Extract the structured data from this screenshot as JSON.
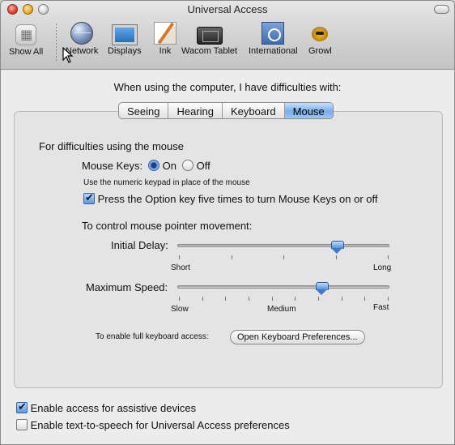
{
  "window": {
    "title": "Universal Access"
  },
  "toolbar": {
    "items": [
      {
        "label": "Show All",
        "icon": "apple-grid-icon"
      },
      {
        "label": "Network",
        "icon": "globe-icon"
      },
      {
        "label": "Displays",
        "icon": "display-icon"
      },
      {
        "label": "Ink",
        "icon": "ink-icon"
      },
      {
        "label": "Wacom Tablet",
        "icon": "tablet-icon"
      },
      {
        "label": "International",
        "icon": "flag-icon"
      },
      {
        "label": "Growl",
        "icon": "growl-icon"
      }
    ]
  },
  "heading": "When using the computer, I have difficulties with:",
  "tabs": [
    "Seeing",
    "Hearing",
    "Keyboard",
    "Mouse"
  ],
  "active_tab": "Mouse",
  "mouse": {
    "section_title": "For difficulties using the mouse",
    "mouse_keys_label": "Mouse Keys:",
    "on_label": "On",
    "off_label": "Off",
    "mouse_keys_selected": "On",
    "hint": "Use the numeric keypad in place of the mouse",
    "option_key_label": "Press the Option key five times to turn Mouse Keys on or off",
    "option_key_checked": true,
    "pointer_heading": "To control mouse pointer movement:",
    "initial_delay": {
      "label": "Initial Delay:",
      "min_label": "Short",
      "max_label": "Long",
      "value": 0.75
    },
    "max_speed": {
      "label": "Maximum Speed:",
      "min_label": "Slow",
      "mid_label": "Medium",
      "max_label": "Fast",
      "value": 0.68
    },
    "keyboard_access_label": "To enable full keyboard access:",
    "keyboard_prefs_button": "Open Keyboard Preferences..."
  },
  "bottom": {
    "assistive_label": "Enable access for assistive devices",
    "assistive_checked": true,
    "tts_label": "Enable text-to-speech for Universal Access preferences",
    "tts_checked": false
  }
}
